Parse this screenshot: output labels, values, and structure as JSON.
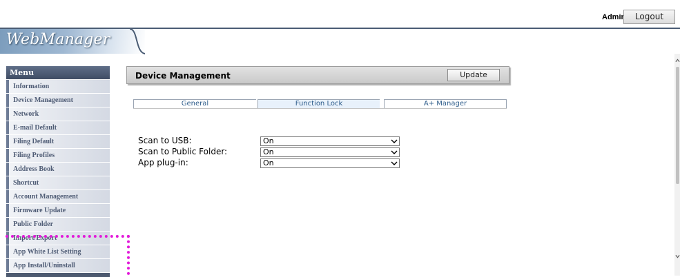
{
  "topbar": {
    "user": "Admin",
    "logout_label": "Logout"
  },
  "header": {
    "logo": "WebManager"
  },
  "menu": {
    "title": "Menu",
    "items": [
      {
        "label": "Information"
      },
      {
        "label": "Device Management"
      },
      {
        "label": "Network"
      },
      {
        "label": "E-mail Default"
      },
      {
        "label": "Filing Default"
      },
      {
        "label": "Filing Profiles"
      },
      {
        "label": "Address Book"
      },
      {
        "label": "Shortcut"
      },
      {
        "label": "Account Management"
      },
      {
        "label": "Firmware Update"
      },
      {
        "label": "Public Folder"
      },
      {
        "label": "Import/Export"
      },
      {
        "label": "App White List Setting"
      },
      {
        "label": "App Install/Uninstall"
      }
    ]
  },
  "panel": {
    "title": "Device Management",
    "update_label": "Update"
  },
  "tabs": [
    {
      "label": "General"
    },
    {
      "label": "Function Lock",
      "selected": true
    },
    {
      "label": "A+ Manager"
    }
  ],
  "form": {
    "fields": [
      {
        "label": "Scan to USB:",
        "value": "On"
      },
      {
        "label": "Scan to Public Folder:",
        "value": "On"
      },
      {
        "label": "App plug-in:",
        "value": "On"
      }
    ]
  },
  "colors": {
    "highlight": "#e21bd9",
    "menu_header": "#4d5a70",
    "tab_selected_bg": "#e8f1fb"
  },
  "icons": {
    "dropdown": "chevron-down-icon"
  }
}
